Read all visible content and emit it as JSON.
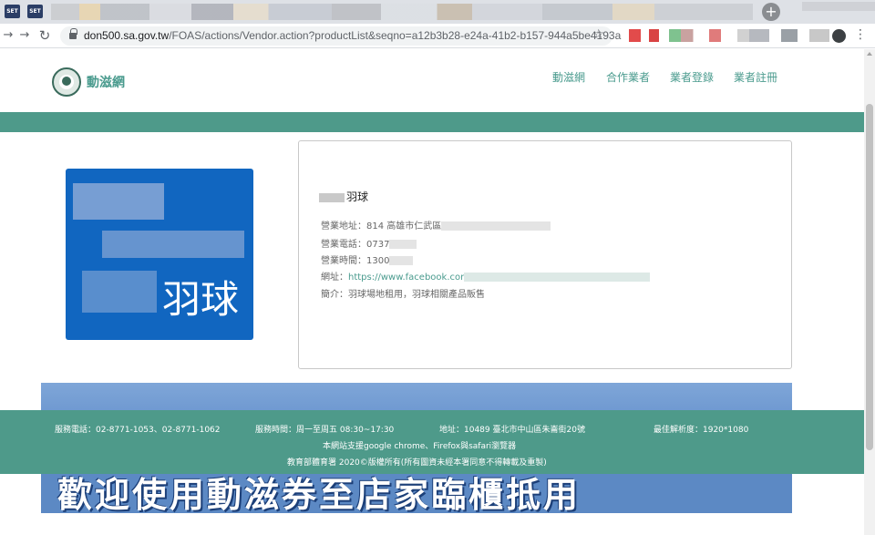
{
  "browser": {
    "tab_favicons": [
      "SET",
      "SET"
    ],
    "url_host": "don500.sa.gov.tw",
    "url_path": "/FOAS/actions/Vendor.action?productList&seqno=a12b3b28-e24a-41b2-b157-944a5be4193a"
  },
  "header": {
    "site_name": "動滋網",
    "nav": [
      "動滋網",
      "合作業者",
      "業者登錄",
      "業者註冊"
    ]
  },
  "vendor": {
    "image_label": "羽球",
    "name": "羽球",
    "address_label": "營業地址：",
    "address": "814 高雄市仁武區",
    "phone_label": "營業電話：",
    "phone": "0737",
    "hours_label": "營業時間：",
    "hours": "1300",
    "website_label": "網址：",
    "website": "https://www.facebook.cor",
    "intro_label": "簡介：",
    "intro": "羽球場地租用，羽球相關產品販售"
  },
  "banner": {
    "text": "歡迎使用動滋券至店家臨櫃抵用"
  },
  "footer": {
    "service_phone": "服務電話：02-8771-1053、02-8771-1062",
    "service_hours": "服務時間：周一至周五 08:30~17:30",
    "address": "地址：10489 臺北市中山區朱崙街20號",
    "resolution": "最佳解析度：1920*1080",
    "browser_support": "本網站支援google chrome、Firefox與safari瀏覽器",
    "copyright": "教育部體育署 2020©版權所有(所有圖資未經本署同意不得轉載及重製)"
  },
  "colors": {
    "accent": "#4e9a8a",
    "link": "#4a9b8e",
    "image_bg": "#1166c0"
  }
}
